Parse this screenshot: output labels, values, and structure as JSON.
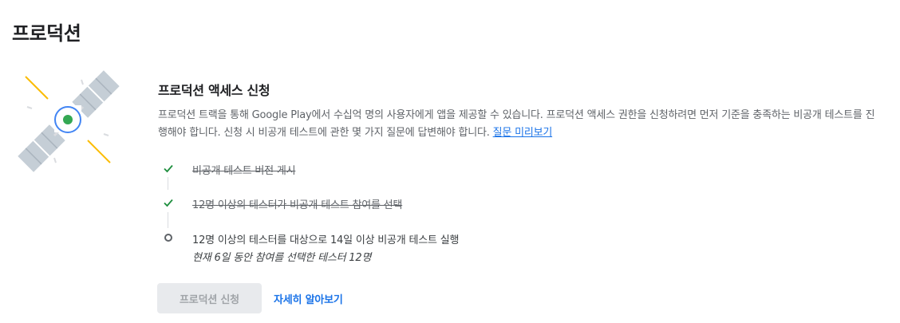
{
  "page": {
    "title": "프로덕션"
  },
  "section": {
    "title": "프로덕션 액세스 신청",
    "description": "프로덕션 트랙을 통해 Google Play에서 수십억 명의 사용자에게 앱을 제공할 수 있습니다. 프로덕션 액세스 권한을 신청하려면 먼저 기준을 충족하는 비공개 테스트를 진행해야 합니다. 신청 시 비공개 테스트에 관한 몇 가지 질문에 답변해야 합니다.",
    "preview_link": "질문 미리보기"
  },
  "steps": [
    {
      "label": "비공개 테스트 버전 게시",
      "status": "completed",
      "icon": "check-icon"
    },
    {
      "label": "12명 이상의 테스터가 비공개 테스트 참여를 선택",
      "status": "completed",
      "icon": "check-icon"
    },
    {
      "label": "12명 이상의 테스터를 대상으로 14일 이상 비공개 테스트 실행",
      "status": "in-progress",
      "icon": "pending-circle-icon",
      "detail": "현재 6일 동안 참여를 선택한 테스터 12명"
    }
  ],
  "actions": {
    "apply_label": "프로덕션 신청",
    "learn_more_label": "자세히 알아보기"
  },
  "colors": {
    "accent": "#1a73e8",
    "check": "#1e8e3e",
    "satellite_panel": "#bdc8d1",
    "satellite_ring": "#4285f4",
    "satellite_core": "#34a853",
    "beam": "#fbbc04"
  }
}
